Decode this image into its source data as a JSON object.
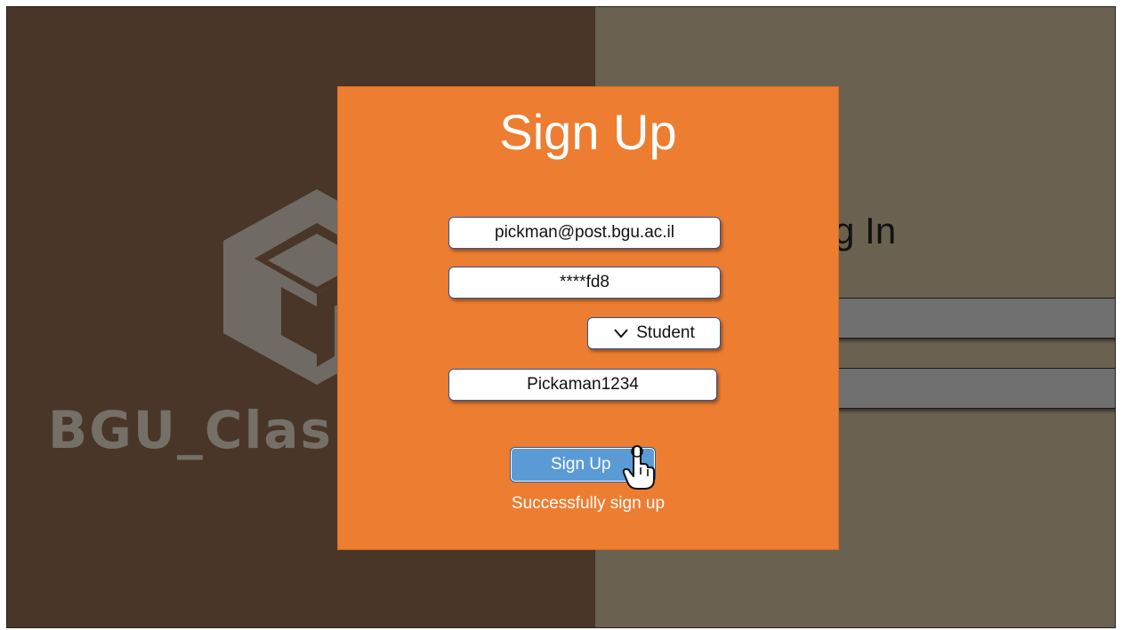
{
  "background": {
    "logo_text": "BGU_Clas",
    "login_title": "g In"
  },
  "signup": {
    "title": "Sign Up",
    "email_value": "pickman@post.bgu.ac.il",
    "password_value": "****fd8",
    "role_selected": "Student",
    "username_value": "Pickaman1234",
    "button_label": "Sign Up",
    "status_message": "Successfully sign up"
  },
  "icons": {
    "logo": "cube-logo-icon",
    "dropdown": "chevron-down-icon",
    "cursor": "hand-pointer-icon"
  },
  "colors": {
    "modal": "#ed7d31",
    "button": "#5b9bd5",
    "left_bg": "#4a3628",
    "right_bg": "#6b6151"
  }
}
